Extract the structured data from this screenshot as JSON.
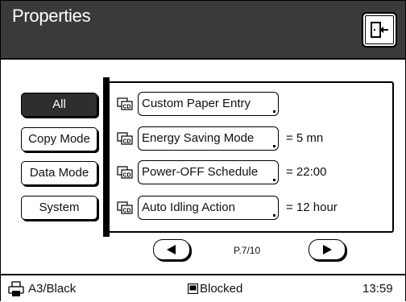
{
  "window": {
    "title": "Properties"
  },
  "header": {
    "exit_icon": "exit-door-icon"
  },
  "categories": [
    {
      "label": "All",
      "active": true
    },
    {
      "label": "Copy Mode",
      "active": false
    },
    {
      "label": "Data Mode",
      "active": false
    },
    {
      "label": "System",
      "active": false
    }
  ],
  "items": [
    {
      "icon": "cd-icon",
      "label": "Custom Paper Entry",
      "value": ""
    },
    {
      "icon": "cd-icon",
      "label": "Energy Saving Mode",
      "value": "= 5 mn"
    },
    {
      "icon": "cd-icon",
      "label": "Power-OFF Schedule",
      "value": "= 22:00"
    },
    {
      "icon": "cd-icon",
      "label": "Auto Idling Action",
      "value": "= 12 hour"
    }
  ],
  "pager": {
    "page_label": "P.7/10",
    "prev_icon": "triangle-left-icon",
    "next_icon": "triangle-right-icon"
  },
  "status": {
    "paper_icon": "printer-paper-icon",
    "paper": "A3/Black",
    "block_icon": "blocked-square-icon",
    "block_text": "Blocked",
    "time": "13:59"
  },
  "colors": {
    "title_bar": "#3a3a3a",
    "active_button": "#2e2e2e",
    "background": "#ffffff"
  }
}
